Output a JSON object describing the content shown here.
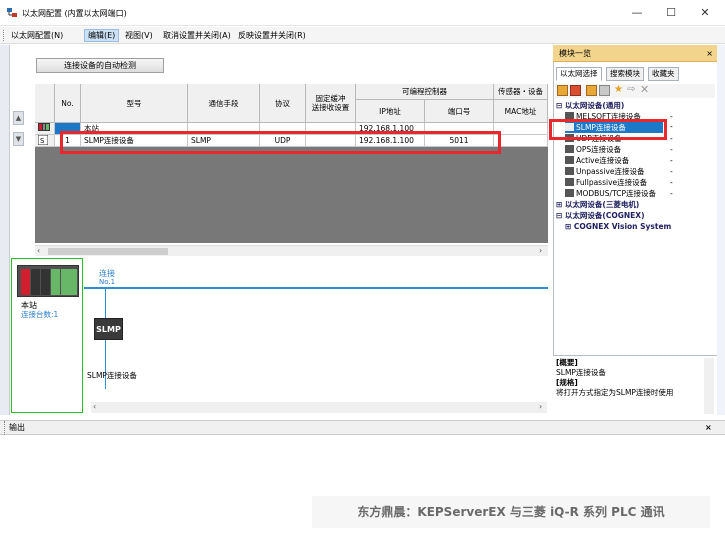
{
  "window": {
    "title": "以太网配置 (内置以太网端口)",
    "minimize": "—",
    "maximize": "☐",
    "close": "✕"
  },
  "menu": {
    "items": [
      "以太网配置(N)",
      "编辑(E)",
      "视图(V)",
      "取消设置并关闭(A)",
      "反映设置并关闭(R)"
    ]
  },
  "toolbar": {
    "detect_button": "连接设备的自动检测"
  },
  "grid": {
    "headers": {
      "no": "No.",
      "model": "型号",
      "comm_method": "通信手段",
      "protocol": "协议",
      "fixed_buffer": "固定缓冲\n送接收设置",
      "plc_group": "可编程控制器",
      "ip": "IP地址",
      "port": "端口号",
      "sensor_group": "传感器・设备",
      "mac": "MAC地址"
    },
    "rows": [
      {
        "icon": "plc-icon",
        "no": "",
        "model": "本站",
        "comm": "",
        "protocol": "",
        "fixed": "",
        "ip": "192.168.1.100",
        "port": "",
        "mac": ""
      },
      {
        "icon": "slmp-device-icon",
        "no": "1",
        "model": "SLMP连接设备",
        "comm": "SLMP",
        "protocol": "UDP",
        "fixed": "",
        "ip": "192.168.1.100",
        "port": "5011",
        "mac": ""
      }
    ]
  },
  "diagram": {
    "station_label": "本站",
    "station_count": "连接台数:1",
    "link_label": "连接",
    "link_no": "No.1",
    "device_box": "SLMP",
    "device_label": "SLMP连接设备"
  },
  "module_panel": {
    "title": "模块一览",
    "close": "×",
    "tabs": [
      "以太网选择",
      "搜索模块",
      "收藏夹"
    ],
    "tree": [
      {
        "label": "以太网设备(通用)",
        "level": 0,
        "bold": true,
        "expander": "⊟"
      },
      {
        "label": "MELSOFT连接设备",
        "level": 1,
        "suffix": "-"
      },
      {
        "label": "SLMP连接设备",
        "level": 1,
        "suffix": "-",
        "selected": true
      },
      {
        "label": "UDP连接设备",
        "level": 1,
        "suffix": "-"
      },
      {
        "label": "OPS连接设备",
        "level": 1,
        "suffix": "-"
      },
      {
        "label": "Active连接设备",
        "level": 1,
        "suffix": "-"
      },
      {
        "label": "Unpassive连接设备",
        "level": 1,
        "suffix": "-"
      },
      {
        "label": "Fullpassive连接设备",
        "level": 1,
        "suffix": "-"
      },
      {
        "label": "MODBUS/TCP连接设备",
        "level": 1,
        "suffix": "-"
      },
      {
        "label": "以太网设备(三菱电机)",
        "level": 0,
        "bold": true,
        "expander": "⊞"
      },
      {
        "label": "以太网设备(COGNEX)",
        "level": 0,
        "bold": true,
        "expander": "⊟"
      },
      {
        "label": "COGNEX Vision System",
        "level": 1,
        "bold": true,
        "expander": "⊞"
      }
    ],
    "desc": {
      "overview_title": "[概要]",
      "overview": "SLMP连接设备",
      "spec_title": "[规格]",
      "spec": "将打开方式指定为SLMP连接时使用"
    }
  },
  "output": {
    "title": "输出",
    "close": "×"
  },
  "watermark": "东方鼎晨：KEPServerEX 与三菱 iQ-R 系列 PLC 通讯",
  "colors": {
    "highlight": "#e8282c",
    "selection": "#1e78c8",
    "network": "#2b8fd5",
    "station_border": "#2bc02b"
  }
}
